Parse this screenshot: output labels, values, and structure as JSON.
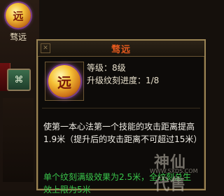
{
  "left_panel": {
    "skill_name": "骛远",
    "skill_icon": "gold-orb-icon",
    "orb_glyph": "远",
    "green_slot_glyph": "⌘"
  },
  "tooltip": {
    "title": "骛远",
    "corner_icon": "✕",
    "level_line": "等级：8级",
    "progress_line": "升级纹刻进度：1/8",
    "icon_glyph": "远",
    "description": "使第一本心法第一个技能的攻击距离提高1.9米（提升后的攻击距离不可超过15米）",
    "bonus": "单个纹刻满级效果为2.5米，全纹刻总生效上限为5米",
    "colors": {
      "title": "#e55a1e",
      "bonus_text": "#39c64b",
      "border": "#9a8454"
    }
  },
  "watermark": {
    "text": "神仙代售",
    "url": "WWW.SXDS.COM"
  }
}
